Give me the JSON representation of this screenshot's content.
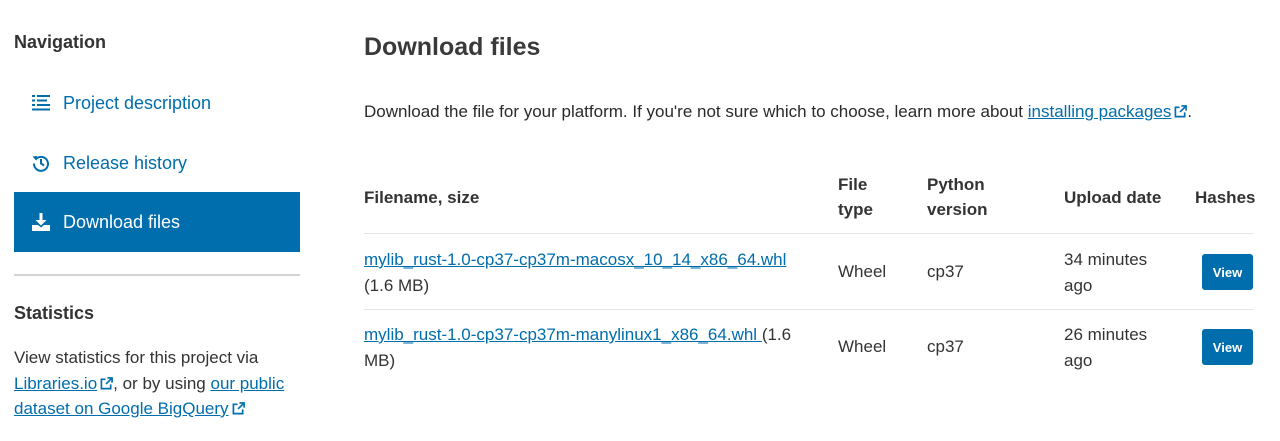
{
  "sidebar": {
    "nav_heading": "Navigation",
    "items": [
      {
        "label": "Project description",
        "icon": "align-left-icon"
      },
      {
        "label": "Release history",
        "icon": "history-icon"
      },
      {
        "label": "Download files",
        "icon": "download-icon",
        "active": true
      }
    ],
    "stats_heading": "Statistics",
    "stats_text_pre": "View statistics for this project via ",
    "stats_link1": "Libraries.io",
    "stats_text_mid": ", or by using ",
    "stats_link2": "our public dataset on Google BigQuery"
  },
  "main": {
    "title": "Download files",
    "intro_text": "Download the file for your platform. If you're not sure which to choose, learn more about ",
    "intro_link": "installing packages",
    "intro_end": ".",
    "columns": {
      "filename": "Filename, size",
      "file_type_1": "File",
      "file_type_2": "type",
      "python_1": "Python",
      "python_2": "version",
      "upload_date": "Upload date",
      "hashes": "Hashes"
    },
    "rows": [
      {
        "filename": "mylib_rust-1.0-cp37-cp37m-macosx_10_14_x86_64.whl",
        "size": " (1.6 MB)",
        "file_type": "Wheel",
        "python": "cp37",
        "upload_date": "34 minutes ago",
        "action": "View"
      },
      {
        "filename": "mylib_rust-1.0-cp37-cp37m-manylinux1_x86_64.whl ",
        "size": "(1.6 MB)",
        "file_type": "Wheel",
        "python": "cp37",
        "upload_date": "26 minutes ago",
        "action": "View"
      }
    ]
  },
  "colors": {
    "accent": "#006dad",
    "divider": "#d3d3d3",
    "text": "#2a2a2a"
  }
}
